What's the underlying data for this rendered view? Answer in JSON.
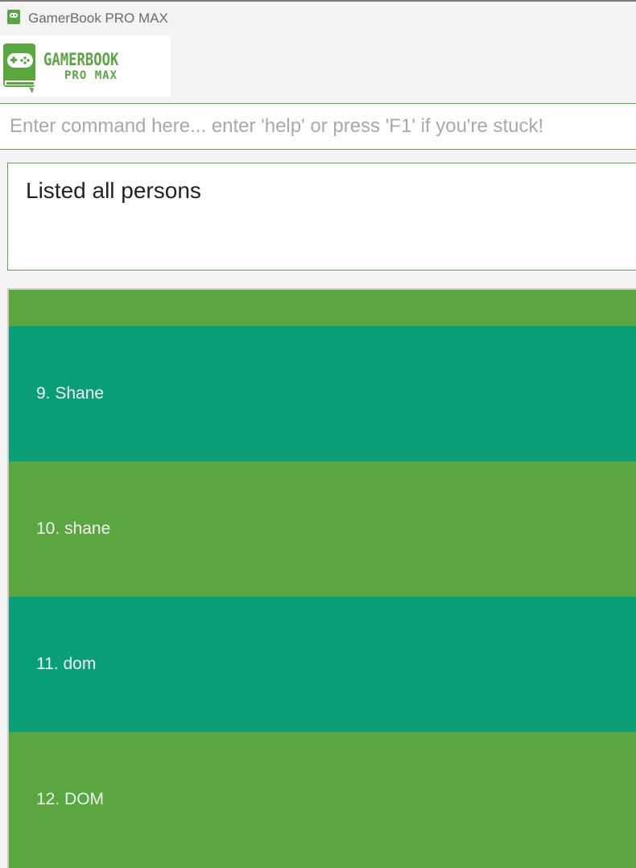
{
  "window": {
    "title": "GamerBook PRO MAX",
    "icon": "gamepad-book-icon"
  },
  "logo": {
    "line1": "GAMERBOOK",
    "line2": "PRO MAX",
    "icon": "gamepad-book-icon"
  },
  "command": {
    "placeholder": "Enter command here... enter 'help' or press 'F1' if you're stuck!",
    "value": ""
  },
  "result": {
    "text": "Listed all persons"
  },
  "persons": [
    {
      "label": "9. Shane",
      "color": "#0a9e76"
    },
    {
      "label": "10. shane",
      "color": "#5aa640"
    },
    {
      "label": "11. dom",
      "color": "#0a9e76"
    },
    {
      "label": "12. DOM",
      "color": "#5aa640"
    }
  ],
  "colors": {
    "accent": "#5aa640",
    "alt_row": "#0a9e76",
    "background": "#f3f3f3"
  }
}
